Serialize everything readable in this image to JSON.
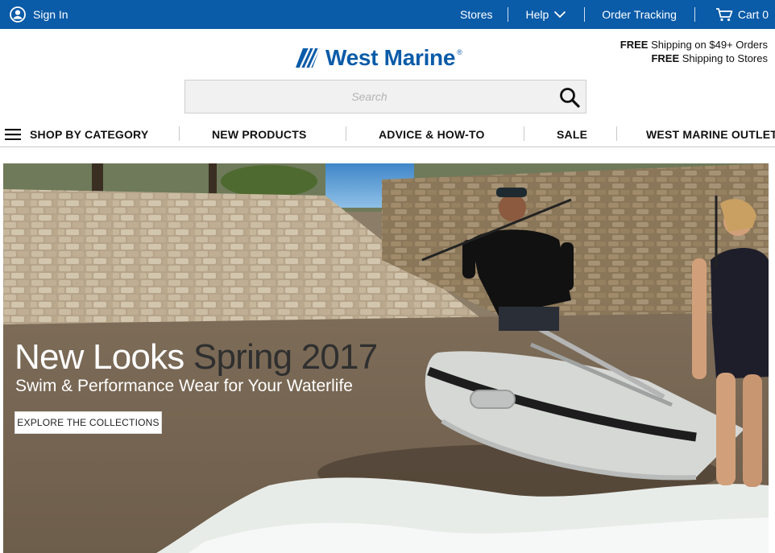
{
  "topbar": {
    "sign_in": "Sign In",
    "stores": "Stores",
    "help": "Help",
    "order_tracking": "Order Tracking",
    "cart": "Cart 0"
  },
  "header": {
    "logo_text": "West Marine",
    "logo_reg": "®",
    "shipping_line1_bold": "FREE",
    "shipping_line1_rest": " Shipping on $49+ Orders",
    "shipping_line2_bold": "FREE",
    "shipping_line2_rest": " Shipping to Stores"
  },
  "search": {
    "placeholder": "Search"
  },
  "nav": {
    "items": [
      "SHOP BY CATEGORY",
      "NEW PRODUCTS",
      "ADVICE & HOW-TO",
      "SALE",
      "WEST MARINE OUTLET"
    ]
  },
  "hero": {
    "title_part1": "New Looks",
    "title_part2": " Spring 2017",
    "subtitle": "Swim & Performance Wear for Your Waterlife",
    "cta": "EXPLORE THE COLLECTIONS"
  },
  "colors": {
    "brand_blue": "#0a5ba8"
  },
  "icons": [
    "user-icon",
    "chevron-down-icon",
    "cart-icon",
    "logo-mark-icon",
    "search-icon",
    "hamburger-menu-icon"
  ]
}
